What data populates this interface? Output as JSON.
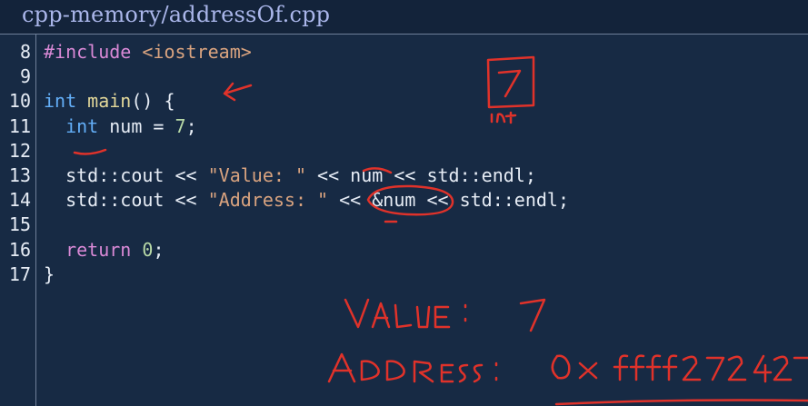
{
  "title": "cpp-memory/addressOf.cpp",
  "lines": [
    {
      "n": "8",
      "tokens": [
        {
          "t": "#include",
          "c": "kw-pre"
        },
        {
          "t": " ",
          "c": "plain"
        },
        {
          "t": "<iostream>",
          "c": "inc"
        }
      ]
    },
    {
      "n": "9",
      "tokens": []
    },
    {
      "n": "10",
      "tokens": [
        {
          "t": "int",
          "c": "kw-type"
        },
        {
          "t": " ",
          "c": "plain"
        },
        {
          "t": "main",
          "c": "fn"
        },
        {
          "t": "() {",
          "c": "plain"
        }
      ]
    },
    {
      "n": "11",
      "tokens": [
        {
          "t": "  ",
          "c": "plain"
        },
        {
          "t": "int",
          "c": "kw-type"
        },
        {
          "t": " num = ",
          "c": "plain"
        },
        {
          "t": "7",
          "c": "num-lit"
        },
        {
          "t": ";",
          "c": "plain"
        }
      ]
    },
    {
      "n": "12",
      "tokens": []
    },
    {
      "n": "13",
      "tokens": [
        {
          "t": "  std::cout << ",
          "c": "plain"
        },
        {
          "t": "\"Value: \"",
          "c": "str"
        },
        {
          "t": " << num << std::endl;",
          "c": "plain"
        }
      ]
    },
    {
      "n": "14",
      "tokens": [
        {
          "t": "  std::cout << ",
          "c": "plain"
        },
        {
          "t": "\"Address: \"",
          "c": "str"
        },
        {
          "t": " << &num << std::endl;",
          "c": "plain"
        }
      ]
    },
    {
      "n": "15",
      "tokens": []
    },
    {
      "n": "16",
      "tokens": [
        {
          "t": "  ",
          "c": "plain"
        },
        {
          "t": "return",
          "c": "kw-ret"
        },
        {
          "t": " ",
          "c": "plain"
        },
        {
          "t": "0",
          "c": "num-lit"
        },
        {
          "t": ";",
          "c": "plain"
        }
      ]
    },
    {
      "n": "17",
      "tokens": [
        {
          "t": "}",
          "c": "plain"
        }
      ]
    }
  ],
  "annotations": {
    "box_value": "7",
    "box_label": "int",
    "output_value": "VALUE: 7",
    "output_address": "ADDRESS: 0x ffff27242",
    "ink_color": "#e0322a"
  }
}
